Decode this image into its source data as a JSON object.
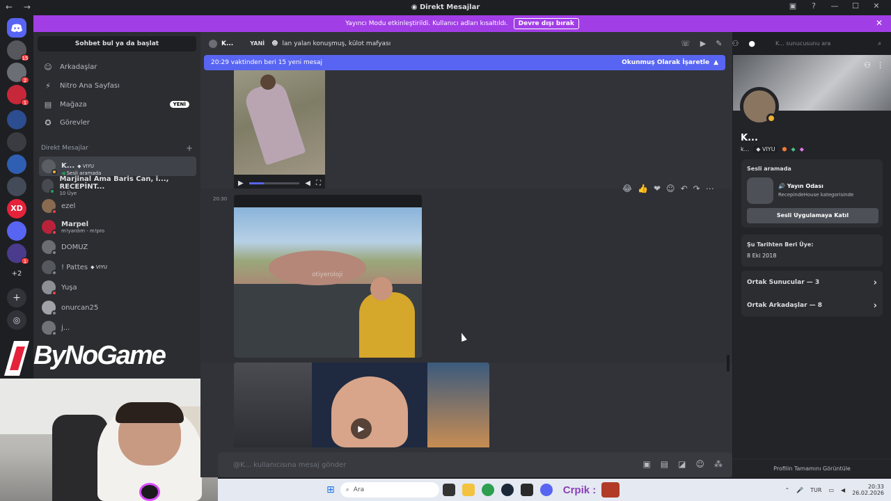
{
  "window": {
    "title": "Direkt Mesajlar",
    "nav_arrows": "← →"
  },
  "banner": {
    "text": "Yayıncı Modu etkinleştirildi. Kullanıcı adları kısaltıldı.",
    "button": "Devre dışı bırak"
  },
  "sidebar": {
    "search_label": "Sohbet bul ya da başlat",
    "nav": [
      {
        "label": "Arkadaşlar",
        "icon": "friends-icon"
      },
      {
        "label": "Nitro Ana Sayfası",
        "icon": "nitro-icon"
      },
      {
        "label": "Mağaza",
        "icon": "shop-icon",
        "badge": "YENİ"
      },
      {
        "label": "Görevler",
        "icon": "quests-icon"
      }
    ],
    "dm_header": "Direkt Mesajlar",
    "dms": [
      {
        "name": "K...",
        "tag": "VIYU",
        "sub": "Sesli aramada",
        "status": "#f0b232"
      },
      {
        "name": "Marjinal Ama Baris Can, i..., RECEPİNT...",
        "sub": "10 Üye"
      },
      {
        "name": "ezel",
        "status": "#f23f43"
      },
      {
        "name": "Marpel",
        "sub": "m!yardım - m!pro",
        "status": "#f23f43"
      },
      {
        "name": "DOMUZ",
        "status": "#80848e"
      },
      {
        "name": "! Pattes",
        "tag": "VIYU",
        "status": "#80848e"
      },
      {
        "name": "Yuşa",
        "status": "#f23f43"
      },
      {
        "name": "onurcan25",
        "status": "#80848e"
      },
      {
        "name": "j...",
        "status": "#80848e"
      }
    ]
  },
  "overlay": {
    "brand": "ByNoGame"
  },
  "chat": {
    "header_name": "K...",
    "header_tag": "YANİ",
    "header_status": "lan yalan konuşmuş, külot mafyası",
    "search_placeholder": "K... sunucusunu ara",
    "new_messages": "20:29 vaktinden beri 15 yeni mesaj",
    "mark_read": "Okunmuş Olarak İşaretle",
    "timestamp": "20:30",
    "watermark": "otiyeroloji",
    "input_placeholder": "@K... kullanıcısına mesaj gönder"
  },
  "profile": {
    "name": "K...",
    "username": "k...",
    "tag": "VIYU",
    "voice_label": "Sesli aramada",
    "voice_channel": "Yayın Odası",
    "voice_category": "RecepindeHouse kategorisinde",
    "join_button": "Sesli Uygulamaya Katıl",
    "member_since_label": "Şu Tarihten Beri Üye:",
    "member_since": "8 Eki 2018",
    "mutual_servers": "Ortak Sunucular — 3",
    "mutual_friends": "Ortak Arkadaşlar — 8",
    "view_full": "Profilin Tamamını Görüntüle"
  },
  "taskbar": {
    "search": "Ara",
    "stream_text": "Crpik :",
    "lang": "TUR",
    "time": "20:33",
    "date": "26.02.2026"
  },
  "servers": {
    "more": "+2"
  }
}
